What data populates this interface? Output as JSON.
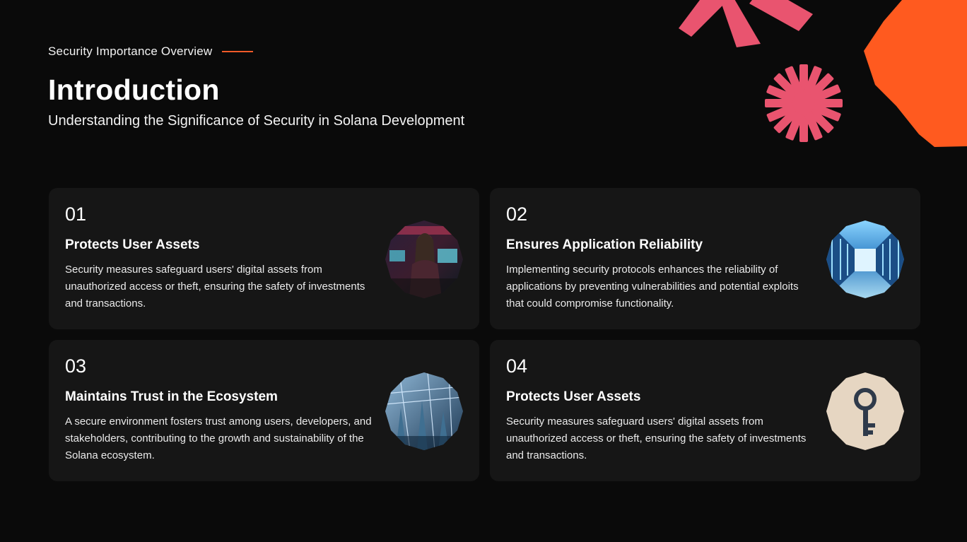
{
  "header": {
    "eyebrow": "Security Importance Overview",
    "title": "Introduction",
    "subtitle": "Understanding the Significance of Security in Solana Development"
  },
  "colors": {
    "background": "#0a0a0a",
    "card": "#161616",
    "accent_line": "#f05a28",
    "pink": "#e9546f",
    "orange": "#ff5a1f"
  },
  "cards": [
    {
      "number": "01",
      "title": "Protects User Assets",
      "description": "Security measures safeguard users' digital assets from unauthorized access or theft, ensuring the safety of investments and transactions.",
      "image": "person-at-computer-image"
    },
    {
      "number": "02",
      "title": "Ensures Application Reliability",
      "description": "Implementing security protocols enhances the reliability of applications by preventing vulnerabilities and potential exploits that could compromise functionality.",
      "image": "server-corridor-image"
    },
    {
      "number": "03",
      "title": "Maintains Trust in the Ecosystem",
      "description": "A secure environment fosters trust among users, developers, and stakeholders, contributing to the growth and sustainability of the Solana ecosystem.",
      "image": "network-towers-image"
    },
    {
      "number": "04",
      "title": "Protects User Assets",
      "description": "Security measures safeguard users' digital assets from unauthorized access or theft, ensuring the safety of investments and transactions.",
      "image": "key-icon-image"
    }
  ]
}
